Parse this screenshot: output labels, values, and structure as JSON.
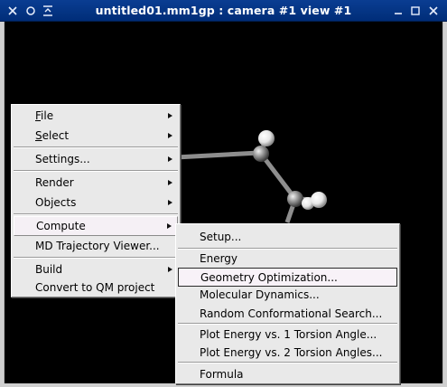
{
  "window": {
    "title": "untitled01.mm1gp : camera #1 view #1"
  },
  "icons": {
    "close": "close-icon",
    "circle": "circle-icon",
    "shade": "shade-icon",
    "minimize": "minimize-icon",
    "maximize": "maximize-icon",
    "close_right": "x-icon"
  },
  "context_menu": {
    "items": [
      {
        "label": "File",
        "mnemonic": "F",
        "rest": "ile",
        "submenu": true
      },
      {
        "label": "Select",
        "mnemonic": "S",
        "rest": "elect",
        "submenu": true
      },
      {
        "label": "Settings...",
        "submenu": true
      },
      {
        "label": "Render",
        "submenu": true
      },
      {
        "label": "Objects",
        "submenu": true
      },
      {
        "label": "Compute",
        "submenu": true,
        "active": true
      },
      {
        "label": "MD Trajectory Viewer...",
        "submenu": false
      },
      {
        "label": "Build",
        "submenu": true
      },
      {
        "label": "Convert to QM project",
        "submenu": false
      }
    ]
  },
  "compute_submenu": {
    "items": [
      {
        "label": "Setup..."
      },
      {
        "label": "Energy"
      },
      {
        "label": "Geometry Optimization...",
        "highlighted": true
      },
      {
        "label": "Molecular Dynamics..."
      },
      {
        "label": "Random Conformational Search..."
      },
      {
        "label": "Plot Energy vs. 1 Torsion Angle..."
      },
      {
        "label": "Plot Energy vs. 2 Torsion Angles..."
      },
      {
        "label": "Formula"
      }
    ]
  },
  "colors": {
    "titlebar": "#0a3d92",
    "menu_bg": "#e9e9e9",
    "viewport_bg": "#000000"
  }
}
